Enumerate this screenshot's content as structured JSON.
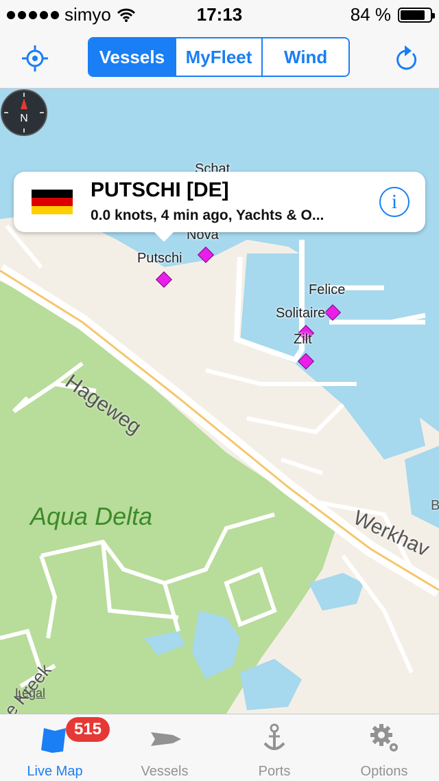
{
  "status_bar": {
    "carrier": "simyo",
    "time": "17:13",
    "battery": "84 %",
    "battery_level": 0.84
  },
  "nav": {
    "segments": [
      {
        "label": "Vessels",
        "active": true
      },
      {
        "label": "MyFleet",
        "active": false
      },
      {
        "label": "Wind",
        "active": false
      }
    ],
    "locate_icon": "crosshair-icon",
    "refresh_icon": "refresh-icon"
  },
  "callout": {
    "vessel_name": "PUTSCHI [DE]",
    "details": "0.0 knots, 4 min ago, Yachts & O...",
    "flag": "germany",
    "flag_colors": [
      "#000000",
      "#dd0000",
      "#ffce00"
    ]
  },
  "map": {
    "vessel_labels": [
      "Schat",
      "Nova",
      "Putschi",
      "Felice",
      "Solitaire",
      "Zilt"
    ],
    "streets": [
      "Hageweg",
      "Werkhav",
      "e Kreek"
    ],
    "area_label": "Aqua Delta",
    "legal": "Legal",
    "edge_label": "B",
    "colors": {
      "water": "#a6d8ee",
      "land": "#f4efe6",
      "park": "#b8dc9a",
      "vessel": "#e91ee9",
      "road": "#f5c66c"
    }
  },
  "tabbar": {
    "badge": "515",
    "tabs": [
      {
        "label": "Live Map",
        "icon": "map-icon",
        "active": true
      },
      {
        "label": "Vessels",
        "icon": "ship-icon",
        "active": false
      },
      {
        "label": "Ports",
        "icon": "anchor-icon",
        "active": false
      },
      {
        "label": "Options",
        "icon": "gear-icon",
        "active": false
      }
    ]
  }
}
